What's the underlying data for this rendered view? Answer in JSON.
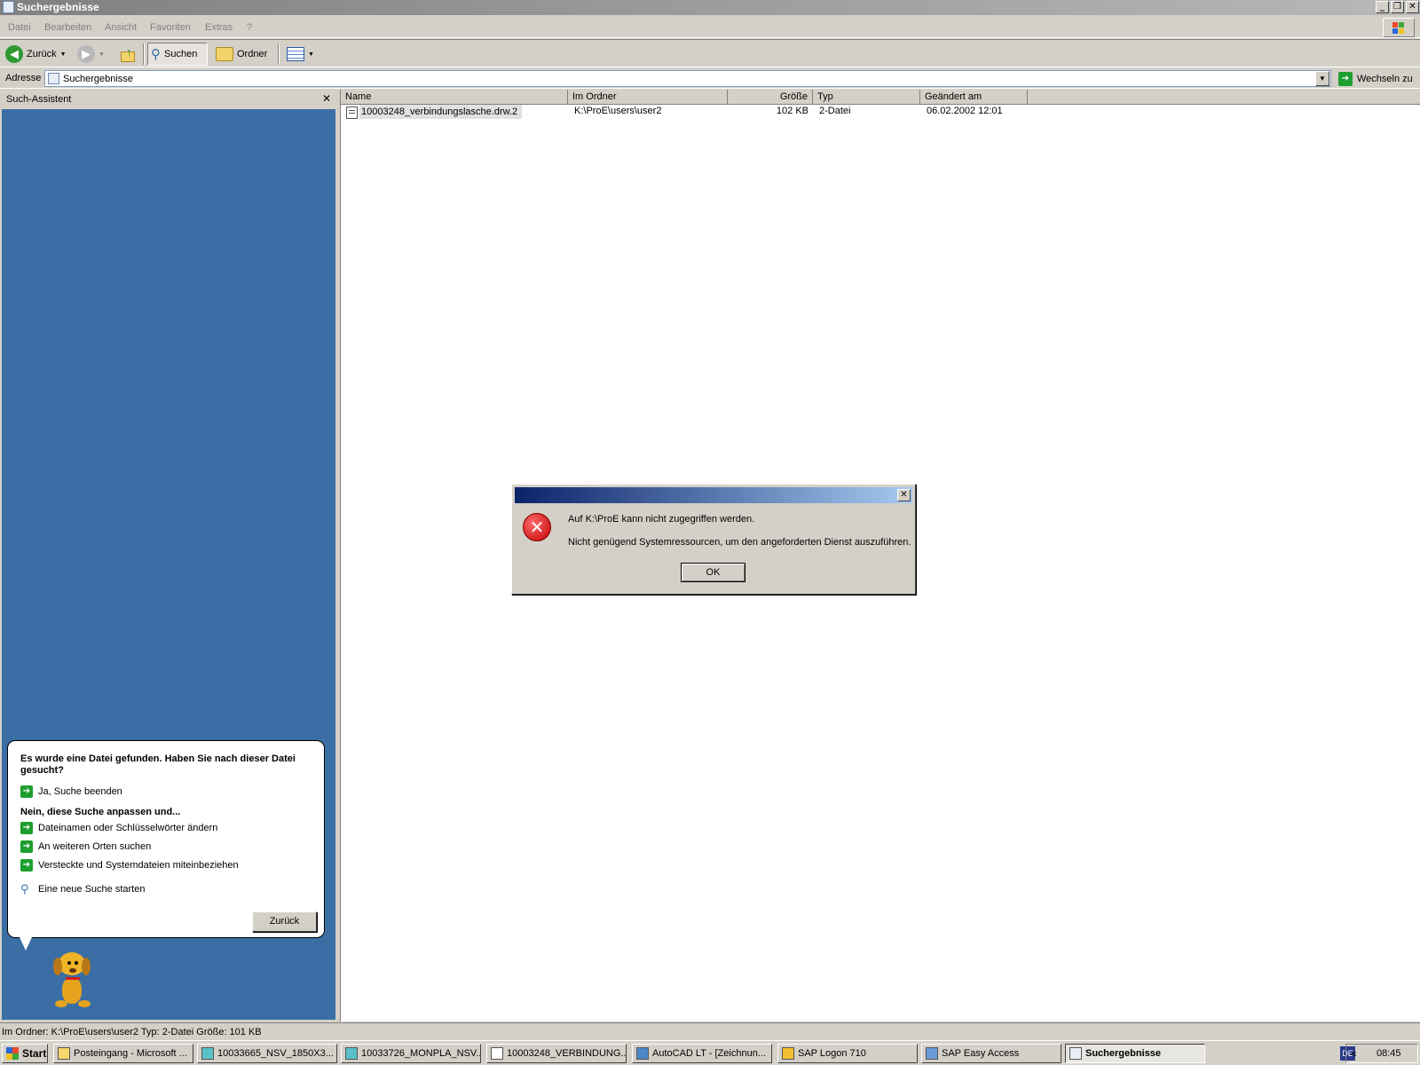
{
  "window": {
    "title": "Suchergebnisse",
    "min": "_",
    "max": "❐",
    "close": "✕"
  },
  "menu": [
    "Datei",
    "Bearbeiten",
    "Ansicht",
    "Favoriten",
    "Extras",
    "?"
  ],
  "toolbar": {
    "back": "Zurück",
    "search": "Suchen",
    "folders": "Ordner"
  },
  "address": {
    "label": "Adresse",
    "value": "Suchergebnisse",
    "go": "Wechseln zu"
  },
  "search_pane": {
    "title": "Such-Assistent",
    "close": "✕",
    "question": "Es wurde eine Datei gefunden. Haben Sie nach dieser Datei gesucht?",
    "yes": "Ja, Suche beenden",
    "refine_heading": "Nein, diese Suche anpassen und...",
    "refine_items": [
      "Dateinamen oder Schlüsselwörter ändern",
      "An weiteren Orten suchen",
      "Versteckte und Systemdateien miteinbeziehen"
    ],
    "new_search": "Eine neue Suche starten",
    "back_button": "Zurück"
  },
  "results": {
    "columns": [
      "Name",
      "Im Ordner",
      "Größe",
      "Typ",
      "Geändert am"
    ],
    "rows": [
      {
        "name": "10003248_verbindungslasche.drw.2",
        "folder": "K:\\ProE\\users\\user2",
        "size": "102 KB",
        "type": "2-Datei",
        "modified": "06.02.2002 12:01"
      }
    ]
  },
  "dialog": {
    "close": "✕",
    "line1": "Auf K:\\ProE kann nicht zugegriffen werden.",
    "line2": "Nicht genügend Systemressourcen, um den angeforderten Dienst auszuführen.",
    "ok": "OK"
  },
  "status": "Im Ordner: K:\\ProE\\users\\user2 Typ: 2-Datei Größe: 101 KB",
  "taskbar": {
    "start": "Start",
    "tasks": [
      "Posteingang - Microsoft ...",
      "10033665_NSV_1850X3...",
      "10033726_MONPLA_NSV...",
      "10003248_VERBINDUNG...",
      "AutoCAD LT - [Zeichnun...",
      "SAP Logon 710",
      "SAP Easy Access",
      "Suchergebnisse"
    ],
    "lang": "DE",
    "clock": "08:45",
    "tray_arrow": "«"
  }
}
